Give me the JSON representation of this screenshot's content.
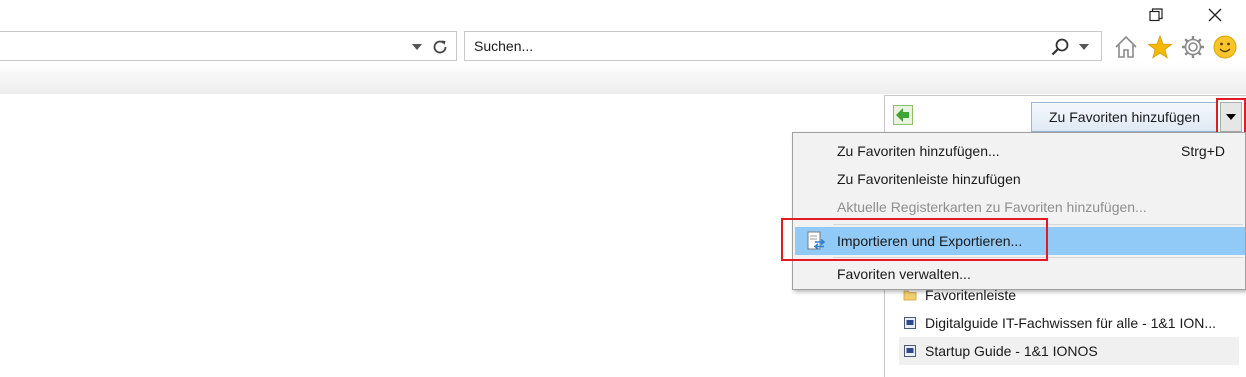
{
  "window": {
    "restore_icon": "restore-icon",
    "close_icon": "close-icon"
  },
  "toolbar": {
    "search_placeholder": "Suchen...",
    "icons": [
      "dropdown-arrow-icon",
      "refresh-icon",
      "search-icon",
      "home-icon",
      "star-icon",
      "gear-icon",
      "smiley-icon"
    ],
    "star_color": "#f5b800"
  },
  "favorites_pane": {
    "add_button_label": "Zu Favoriten hinzufügen",
    "items": [
      {
        "label": "Favoritenleiste",
        "icon": "folder-icon"
      },
      {
        "label": "Digitalguide  IT-Fachwissen für alle - 1&1 ION...",
        "icon": "page-icon"
      },
      {
        "label": "Startup Guide - 1&1 IONOS",
        "icon": "page-icon"
      }
    ]
  },
  "menu": {
    "items": [
      {
        "label": "Zu Favoriten hinzufügen...",
        "shortcut": "Strg+D",
        "enabled": true
      },
      {
        "label": "Zu Favoritenleiste hinzufügen",
        "enabled": true
      },
      {
        "label": "Aktuelle Registerkarten zu Favoriten hinzufügen...",
        "enabled": false
      },
      {
        "label": "Importieren und Exportieren...",
        "enabled": true,
        "highlighted": true,
        "icon": "import-export-icon"
      },
      {
        "label": "Favoriten verwalten...",
        "enabled": true
      }
    ],
    "highlight_color": "#91c9f7",
    "annotation_color": "#e01b24"
  }
}
